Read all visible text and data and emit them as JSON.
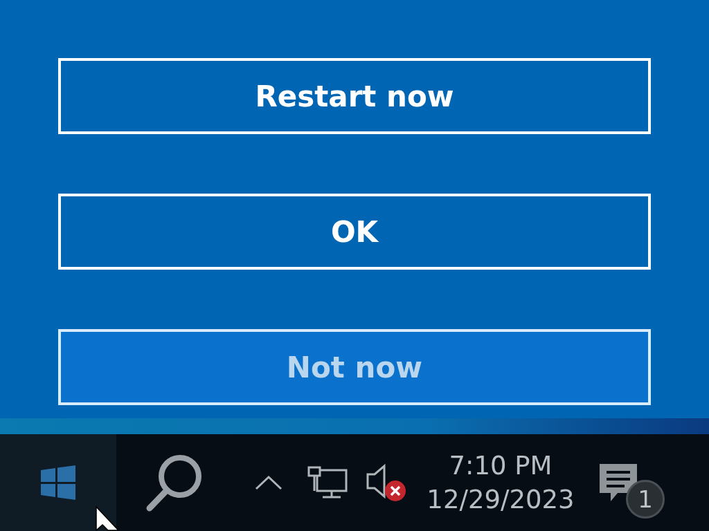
{
  "buttons": [
    {
      "label": "Restart now",
      "selected": false
    },
    {
      "label": "OK",
      "selected": false
    },
    {
      "label": "Not now",
      "selected": true
    }
  ],
  "taskbar": {
    "volume": {
      "muted": true
    },
    "time": "7:10 PM",
    "date": "12/29/2023",
    "notification_count": "1"
  }
}
